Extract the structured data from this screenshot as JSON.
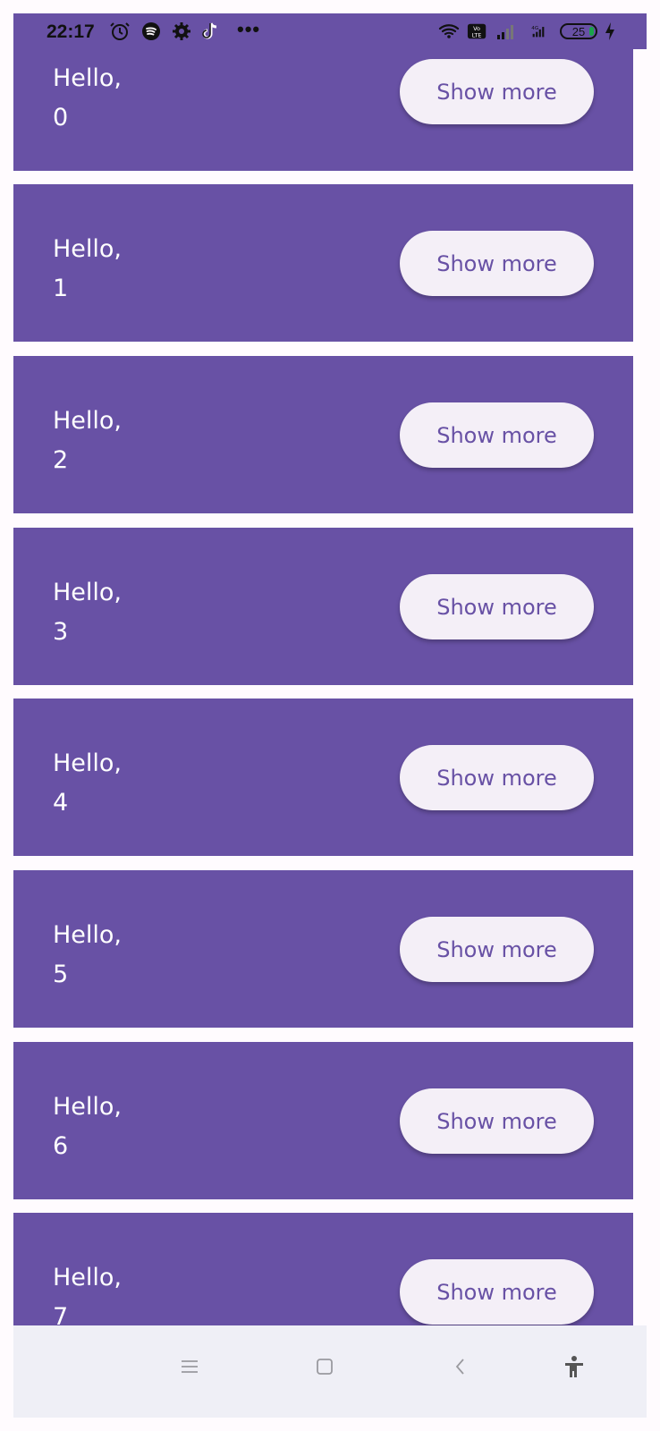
{
  "status_bar": {
    "time": "22:17",
    "battery_level": "25",
    "network_label": "4G",
    "icons": [
      "alarm-icon",
      "spotify-icon",
      "settings-icon",
      "tiktok-icon",
      "overflow-dots-icon",
      "wifi-icon",
      "volte-icon",
      "signal-icon",
      "signal-4g-icon",
      "battery-icon",
      "charging-icon"
    ]
  },
  "list": {
    "items": [
      {
        "greeting": "Hello,",
        "index": "0",
        "button_label": "Show more"
      },
      {
        "greeting": "Hello,",
        "index": "1",
        "button_label": "Show more"
      },
      {
        "greeting": "Hello,",
        "index": "2",
        "button_label": "Show more"
      },
      {
        "greeting": "Hello,",
        "index": "3",
        "button_label": "Show more"
      },
      {
        "greeting": "Hello,",
        "index": "4",
        "button_label": "Show more"
      },
      {
        "greeting": "Hello,",
        "index": "5",
        "button_label": "Show more"
      },
      {
        "greeting": "Hello,",
        "index": "6",
        "button_label": "Show more"
      },
      {
        "greeting": "Hello,",
        "index": "7",
        "button_label": "Show more"
      }
    ]
  },
  "navigation_bar": {
    "icons": [
      "menu-icon",
      "home-icon",
      "back-icon",
      "accessibility-icon"
    ]
  },
  "colors": {
    "card_background": "#6851a5",
    "button_background": "#f4eff7",
    "button_text": "#6851a5",
    "page_background": "#fffbfe",
    "navigation_bar": "#efeff6"
  }
}
